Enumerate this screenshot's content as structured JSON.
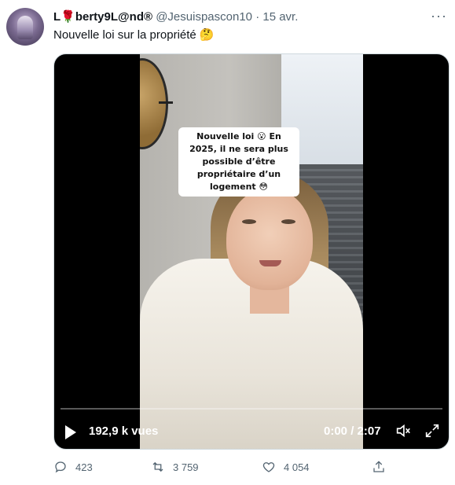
{
  "tweet": {
    "author_name": "L🌹berty9L@nd®",
    "handle": "@Jesuispascon10",
    "separator": "·",
    "date": "15 avr.",
    "more_label": "···",
    "text": "Nouvelle loi sur la propriété 🤔"
  },
  "video": {
    "caption": "Nouvelle loi 😮 En 2025, il ne sera plus possible d’être propriétaire d’un logement 😳",
    "views": "192,9 k vues",
    "time": "0:00 / 2:07",
    "progress": 0,
    "icons": [
      "play-icon",
      "volume-icon",
      "expand-icon"
    ]
  },
  "actions": {
    "reply_count": "423",
    "retweet_count": "3 759",
    "like_count": "4 054",
    "icons": [
      "reply-icon",
      "retweet-icon",
      "like-icon",
      "share-icon"
    ]
  },
  "colors": {
    "text": "#0f1419",
    "secondary": "#536471",
    "media_bg": "#000000"
  }
}
